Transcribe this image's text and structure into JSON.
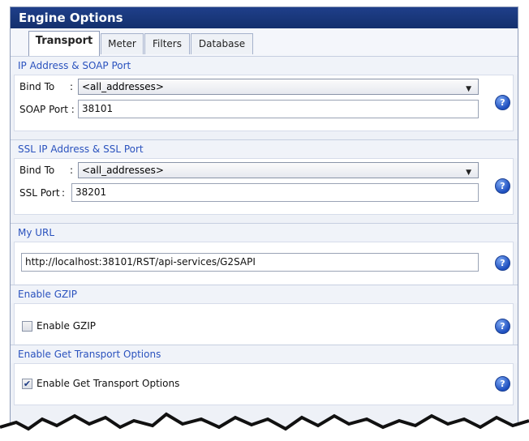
{
  "window": {
    "title": "Engine Options"
  },
  "tabs": [
    {
      "label": "Transport",
      "active": true
    },
    {
      "label": "Meter",
      "active": false
    },
    {
      "label": "Filters",
      "active": false
    },
    {
      "label": "Database",
      "active": false
    }
  ],
  "soap": {
    "header": "IP Address & SOAP Port",
    "bind_label": "Bind To",
    "bind_colon": ":",
    "bind_value": "<all_addresses>",
    "port_label": "SOAP Port :",
    "port_value": "38101"
  },
  "ssl": {
    "header": "SSL IP Address & SSL Port",
    "bind_label": "Bind To",
    "bind_colon": ":",
    "bind_value": "<all_addresses>",
    "port_label": "SSL Port",
    "port_colon": ":",
    "port_value": "38201"
  },
  "url": {
    "header": "My URL",
    "value": "http://localhost:38101/RST/api-services/G2SAPI"
  },
  "gzip": {
    "header": "Enable GZIP",
    "checkbox_label": "Enable GZIP",
    "checked": false
  },
  "transport_options": {
    "header": "Enable Get Transport Options",
    "checkbox_label": "Enable Get Transport Options",
    "checked": true
  },
  "icons": {
    "help": "question-mark-icon",
    "dropdown": "chevron-down-icon",
    "check": "checkmark-icon"
  },
  "colors": {
    "titlebar": "#1f3f8a",
    "group_header_text": "#2a52be",
    "help_icon": "#1e4fbf"
  }
}
